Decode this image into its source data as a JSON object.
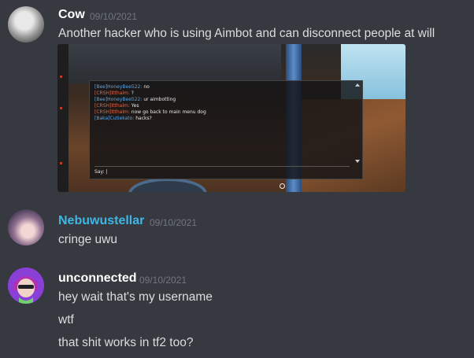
{
  "messages": [
    {
      "username": "Cow",
      "username_color": "#ffffff",
      "timestamp": "09/10/2021",
      "lines": [
        "Another hacker who is using Aimbot and can disconnect people at will"
      ]
    },
    {
      "username": "Nebuwustellar",
      "username_color": "#3fb6e6",
      "timestamp": "09/10/2021",
      "lines": [
        "cringe uwu"
      ]
    },
    {
      "username": "unconnected",
      "username_color": "#ffffff",
      "timestamp": "09/10/2021",
      "lines": [
        "hey wait that's my username",
        "wtf",
        "that shit works in tf2 too?"
      ]
    }
  ],
  "attachment": {
    "chat_lines": [
      {
        "tag": "[Bee]HoneyBee522:",
        "text": "no"
      },
      {
        "tag": "[CRSH]Itthalm:",
        "text": "?"
      },
      {
        "tag": "[Bee]HoneyBee522:",
        "text": "ur aimbotting"
      },
      {
        "tag": "[CRSH]Itthalm:",
        "text": "Yes"
      },
      {
        "tag": "[CRSH]Itthalm:",
        "text": "now go back to main menu dog"
      },
      {
        "tag": "[Baka]Cutiekato:",
        "text": "hacks?"
      }
    ],
    "say_label": "Say: |"
  }
}
